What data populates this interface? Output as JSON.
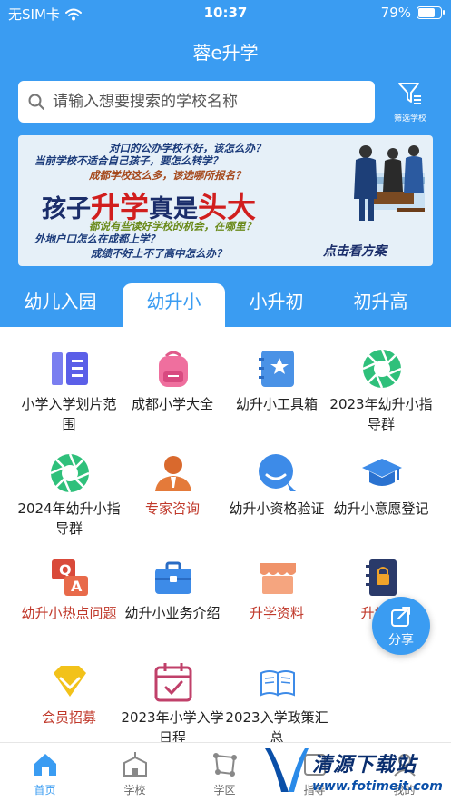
{
  "status_bar": {
    "carrier": "无SIM卡",
    "time": "10:37",
    "battery_percent": "79%",
    "battery_level": 0.79
  },
  "app": {
    "title": "蓉e升学"
  },
  "search": {
    "placeholder": "请输入想要搜索的学校名称",
    "filter_label": "筛选学校"
  },
  "banner": {
    "lines": [
      "对口的公办学校不好，该怎么办？",
      "当前学校不适合自己孩子，要怎么转学？",
      "成都学校这么多，该选哪所报名？",
      "都说有些读好学校的机会，在哪里？",
      "外地户口怎么在成都上学？",
      "成绩不好上不了高中怎么办？"
    ],
    "headline_1": "孩子",
    "headline_2": "升学",
    "headline_3": "真是",
    "headline_4": "头大",
    "cta": "点击看方案"
  },
  "tabs": [
    "幼儿入园",
    "幼升小",
    "小升初",
    "初升高"
  ],
  "active_tab": 1,
  "grid": [
    {
      "label": "小学入学划片范围",
      "icon": "list-columns-icon",
      "red": false
    },
    {
      "label": "成都小学大全",
      "icon": "backpack-icon",
      "red": false
    },
    {
      "label": "幼升小工具箱",
      "icon": "notebook-star-icon",
      "red": false
    },
    {
      "label": "2023年幼升小指导群",
      "icon": "aperture-icon",
      "red": false
    },
    {
      "label": "2024年幼升小指导群",
      "icon": "aperture-icon",
      "red": false
    },
    {
      "label": "专家咨询",
      "icon": "expert-person-icon",
      "red": true
    },
    {
      "label": "幼升小资格验证",
      "icon": "search-bubble-icon",
      "red": false
    },
    {
      "label": "幼升小意愿登记",
      "icon": "graduation-cap-icon",
      "red": false
    },
    {
      "label": "幼升小热点问题",
      "icon": "qa-icon",
      "red": true
    },
    {
      "label": "幼升小业务介绍",
      "icon": "briefcase-icon",
      "red": false
    },
    {
      "label": "升学资料",
      "icon": "store-icon",
      "red": true
    },
    {
      "label": "升学记",
      "icon": "lock-notebook-icon",
      "red": true
    },
    {
      "label": "会员招募",
      "icon": "diamond-icon",
      "red": true
    },
    {
      "label": "2023年小学入学日程",
      "icon": "calendar-check-icon",
      "red": false
    },
    {
      "label": "2023入学政策汇总",
      "icon": "open-book-icon",
      "red": false
    }
  ],
  "fab": {
    "label": "分享",
    "icon": "share-icon"
  },
  "bottom_nav": [
    {
      "label": "首页",
      "icon": "home-icon"
    },
    {
      "label": "学校",
      "icon": "school-icon"
    },
    {
      "label": "学区",
      "icon": "district-icon"
    },
    {
      "label": "指导",
      "icon": "guide-icon"
    },
    {
      "label": "我的",
      "icon": "profile-icon"
    }
  ],
  "active_nav": 0,
  "watermark": {
    "title": "清源下载站",
    "url": "www.fotimeit.com"
  },
  "colors": {
    "primary": "#3a9cf2",
    "red_label": "#c0392b"
  }
}
